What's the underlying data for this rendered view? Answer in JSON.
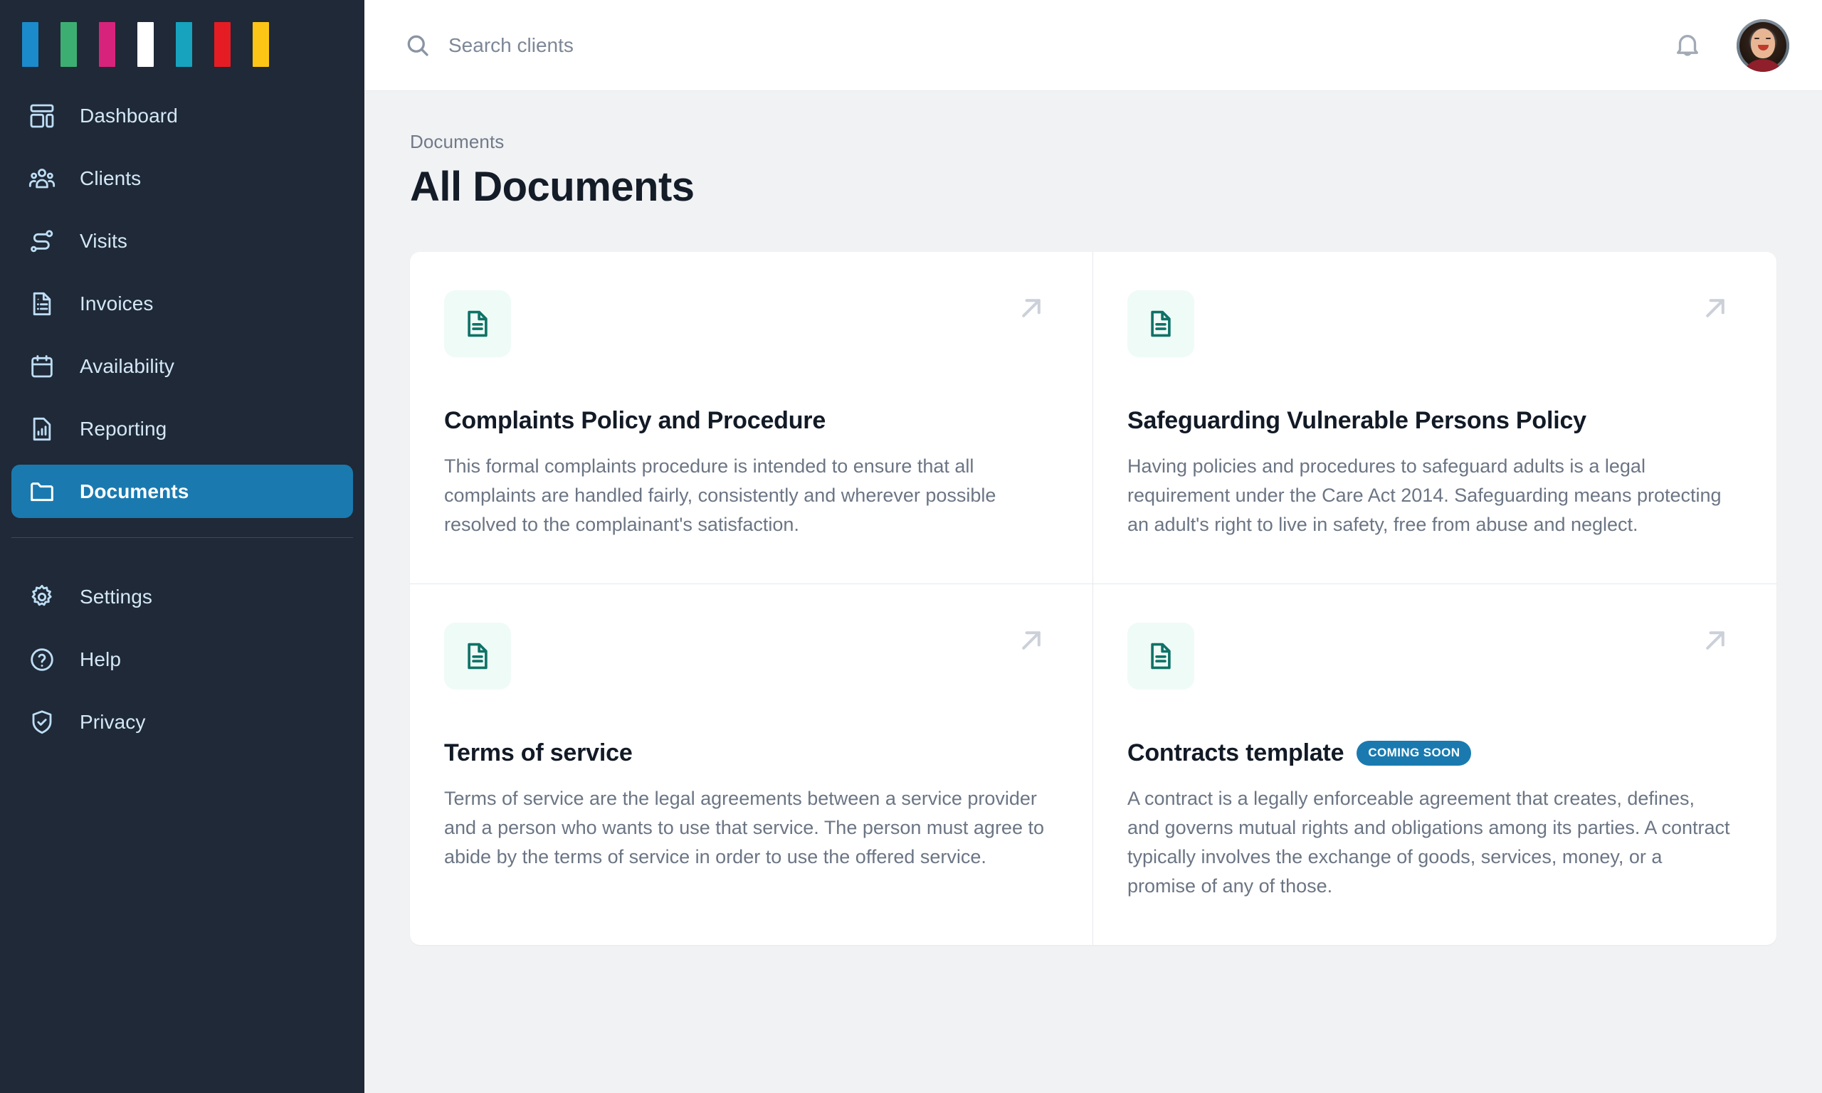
{
  "brand": {
    "logo_bars": [
      {
        "name": "logo-bar-blue",
        "color": "#1B8BCB"
      },
      {
        "name": "logo-bar-green",
        "color": "#3DAE72"
      },
      {
        "name": "logo-bar-magenta",
        "color": "#D8237C"
      },
      {
        "name": "logo-bar-white",
        "color": "#FFFFFF"
      },
      {
        "name": "logo-bar-teal",
        "color": "#17A2BE"
      },
      {
        "name": "logo-bar-red",
        "color": "#E61C24"
      },
      {
        "name": "logo-bar-yellow",
        "color": "#FDC515"
      }
    ],
    "active_color": "#1A7AB0",
    "sidebar_color": "#1F2937",
    "accent_teal": "#0E7267"
  },
  "sidebar": {
    "items": [
      {
        "label": "Dashboard",
        "icon": "dashboard-icon",
        "active": false
      },
      {
        "label": "Clients",
        "icon": "users-icon",
        "active": false
      },
      {
        "label": "Visits",
        "icon": "route-icon",
        "active": false
      },
      {
        "label": "Invoices",
        "icon": "invoice-icon",
        "active": false
      },
      {
        "label": "Availability",
        "icon": "calendar-icon",
        "active": false
      },
      {
        "label": "Reporting",
        "icon": "report-chart-icon",
        "active": false
      },
      {
        "label": "Documents",
        "icon": "folder-icon",
        "active": true
      }
    ],
    "footer_items": [
      {
        "label": "Settings",
        "icon": "gear-icon"
      },
      {
        "label": "Help",
        "icon": "question-circle-icon"
      },
      {
        "label": "Privacy",
        "icon": "shield-check-icon"
      }
    ]
  },
  "topbar": {
    "search": {
      "placeholder": "Search clients",
      "value": "",
      "icon": "search-icon"
    },
    "notifications_icon": "bell-icon",
    "avatar": "user-avatar"
  },
  "page": {
    "breadcrumb": "Documents",
    "title": "All Documents"
  },
  "documents": [
    {
      "title": "Complaints Policy and Procedure",
      "description": "This formal complaints procedure is intended to ensure that all complaints are handled fairly, consistently and wherever possible resolved to the complainant's satisfaction.",
      "badge": "",
      "icon": "document-icon",
      "open_icon": "arrow-up-right-icon"
    },
    {
      "title": "Safeguarding Vulnerable Persons Policy",
      "description": "Having policies and procedures to safeguard adults is a legal requirement under the Care Act 2014. Safeguarding means protecting an adult's right to live in safety, free from abuse and neglect.",
      "badge": "",
      "icon": "document-icon",
      "open_icon": "arrow-up-right-icon"
    },
    {
      "title": "Terms of service",
      "description": "Terms of service are the legal agreements between a service provider and a person who wants to use that service. The person must agree to abide by the terms of service in order to use the offered service.",
      "badge": "",
      "icon": "document-icon",
      "open_icon": "arrow-up-right-icon"
    },
    {
      "title": "Contracts template",
      "description": "A contract is a legally enforceable agreement that creates, defines, and governs mutual rights and obligations among its parties. A contract typically involves the exchange of goods, services, money, or a promise of any of those.",
      "badge": "COMING SOON",
      "icon": "document-icon",
      "open_icon": "arrow-up-right-icon"
    }
  ]
}
